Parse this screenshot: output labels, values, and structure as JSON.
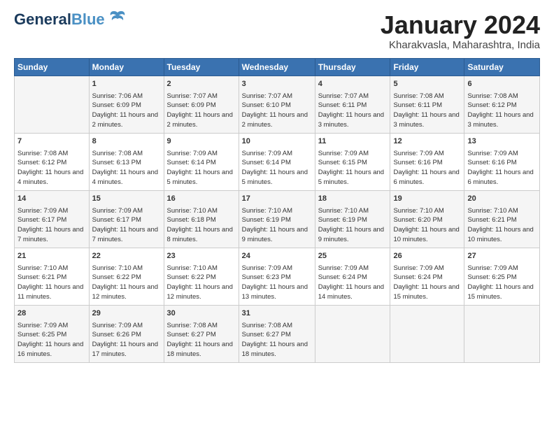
{
  "header": {
    "logo_general": "General",
    "logo_blue": "Blue",
    "month_title": "January 2024",
    "location": "Kharakvasla, Maharashtra, India"
  },
  "days_of_week": [
    "Sunday",
    "Monday",
    "Tuesday",
    "Wednesday",
    "Thursday",
    "Friday",
    "Saturday"
  ],
  "weeks": [
    [
      {
        "day": "",
        "sunrise": "",
        "sunset": "",
        "daylight": ""
      },
      {
        "day": "1",
        "sunrise": "Sunrise: 7:06 AM",
        "sunset": "Sunset: 6:09 PM",
        "daylight": "Daylight: 11 hours and 2 minutes."
      },
      {
        "day": "2",
        "sunrise": "Sunrise: 7:07 AM",
        "sunset": "Sunset: 6:09 PM",
        "daylight": "Daylight: 11 hours and 2 minutes."
      },
      {
        "day": "3",
        "sunrise": "Sunrise: 7:07 AM",
        "sunset": "Sunset: 6:10 PM",
        "daylight": "Daylight: 11 hours and 2 minutes."
      },
      {
        "day": "4",
        "sunrise": "Sunrise: 7:07 AM",
        "sunset": "Sunset: 6:11 PM",
        "daylight": "Daylight: 11 hours and 3 minutes."
      },
      {
        "day": "5",
        "sunrise": "Sunrise: 7:08 AM",
        "sunset": "Sunset: 6:11 PM",
        "daylight": "Daylight: 11 hours and 3 minutes."
      },
      {
        "day": "6",
        "sunrise": "Sunrise: 7:08 AM",
        "sunset": "Sunset: 6:12 PM",
        "daylight": "Daylight: 11 hours and 3 minutes."
      }
    ],
    [
      {
        "day": "7",
        "sunrise": "Sunrise: 7:08 AM",
        "sunset": "Sunset: 6:12 PM",
        "daylight": "Daylight: 11 hours and 4 minutes."
      },
      {
        "day": "8",
        "sunrise": "Sunrise: 7:08 AM",
        "sunset": "Sunset: 6:13 PM",
        "daylight": "Daylight: 11 hours and 4 minutes."
      },
      {
        "day": "9",
        "sunrise": "Sunrise: 7:09 AM",
        "sunset": "Sunset: 6:14 PM",
        "daylight": "Daylight: 11 hours and 5 minutes."
      },
      {
        "day": "10",
        "sunrise": "Sunrise: 7:09 AM",
        "sunset": "Sunset: 6:14 PM",
        "daylight": "Daylight: 11 hours and 5 minutes."
      },
      {
        "day": "11",
        "sunrise": "Sunrise: 7:09 AM",
        "sunset": "Sunset: 6:15 PM",
        "daylight": "Daylight: 11 hours and 5 minutes."
      },
      {
        "day": "12",
        "sunrise": "Sunrise: 7:09 AM",
        "sunset": "Sunset: 6:16 PM",
        "daylight": "Daylight: 11 hours and 6 minutes."
      },
      {
        "day": "13",
        "sunrise": "Sunrise: 7:09 AM",
        "sunset": "Sunset: 6:16 PM",
        "daylight": "Daylight: 11 hours and 6 minutes."
      }
    ],
    [
      {
        "day": "14",
        "sunrise": "Sunrise: 7:09 AM",
        "sunset": "Sunset: 6:17 PM",
        "daylight": "Daylight: 11 hours and 7 minutes."
      },
      {
        "day": "15",
        "sunrise": "Sunrise: 7:09 AM",
        "sunset": "Sunset: 6:17 PM",
        "daylight": "Daylight: 11 hours and 7 minutes."
      },
      {
        "day": "16",
        "sunrise": "Sunrise: 7:10 AM",
        "sunset": "Sunset: 6:18 PM",
        "daylight": "Daylight: 11 hours and 8 minutes."
      },
      {
        "day": "17",
        "sunrise": "Sunrise: 7:10 AM",
        "sunset": "Sunset: 6:19 PM",
        "daylight": "Daylight: 11 hours and 9 minutes."
      },
      {
        "day": "18",
        "sunrise": "Sunrise: 7:10 AM",
        "sunset": "Sunset: 6:19 PM",
        "daylight": "Daylight: 11 hours and 9 minutes."
      },
      {
        "day": "19",
        "sunrise": "Sunrise: 7:10 AM",
        "sunset": "Sunset: 6:20 PM",
        "daylight": "Daylight: 11 hours and 10 minutes."
      },
      {
        "day": "20",
        "sunrise": "Sunrise: 7:10 AM",
        "sunset": "Sunset: 6:21 PM",
        "daylight": "Daylight: 11 hours and 10 minutes."
      }
    ],
    [
      {
        "day": "21",
        "sunrise": "Sunrise: 7:10 AM",
        "sunset": "Sunset: 6:21 PM",
        "daylight": "Daylight: 11 hours and 11 minutes."
      },
      {
        "day": "22",
        "sunrise": "Sunrise: 7:10 AM",
        "sunset": "Sunset: 6:22 PM",
        "daylight": "Daylight: 11 hours and 12 minutes."
      },
      {
        "day": "23",
        "sunrise": "Sunrise: 7:10 AM",
        "sunset": "Sunset: 6:22 PM",
        "daylight": "Daylight: 11 hours and 12 minutes."
      },
      {
        "day": "24",
        "sunrise": "Sunrise: 7:09 AM",
        "sunset": "Sunset: 6:23 PM",
        "daylight": "Daylight: 11 hours and 13 minutes."
      },
      {
        "day": "25",
        "sunrise": "Sunrise: 7:09 AM",
        "sunset": "Sunset: 6:24 PM",
        "daylight": "Daylight: 11 hours and 14 minutes."
      },
      {
        "day": "26",
        "sunrise": "Sunrise: 7:09 AM",
        "sunset": "Sunset: 6:24 PM",
        "daylight": "Daylight: 11 hours and 15 minutes."
      },
      {
        "day": "27",
        "sunrise": "Sunrise: 7:09 AM",
        "sunset": "Sunset: 6:25 PM",
        "daylight": "Daylight: 11 hours and 15 minutes."
      }
    ],
    [
      {
        "day": "28",
        "sunrise": "Sunrise: 7:09 AM",
        "sunset": "Sunset: 6:25 PM",
        "daylight": "Daylight: 11 hours and 16 minutes."
      },
      {
        "day": "29",
        "sunrise": "Sunrise: 7:09 AM",
        "sunset": "Sunset: 6:26 PM",
        "daylight": "Daylight: 11 hours and 17 minutes."
      },
      {
        "day": "30",
        "sunrise": "Sunrise: 7:08 AM",
        "sunset": "Sunset: 6:27 PM",
        "daylight": "Daylight: 11 hours and 18 minutes."
      },
      {
        "day": "31",
        "sunrise": "Sunrise: 7:08 AM",
        "sunset": "Sunset: 6:27 PM",
        "daylight": "Daylight: 11 hours and 18 minutes."
      },
      {
        "day": "",
        "sunrise": "",
        "sunset": "",
        "daylight": ""
      },
      {
        "day": "",
        "sunrise": "",
        "sunset": "",
        "daylight": ""
      },
      {
        "day": "",
        "sunrise": "",
        "sunset": "",
        "daylight": ""
      }
    ]
  ]
}
